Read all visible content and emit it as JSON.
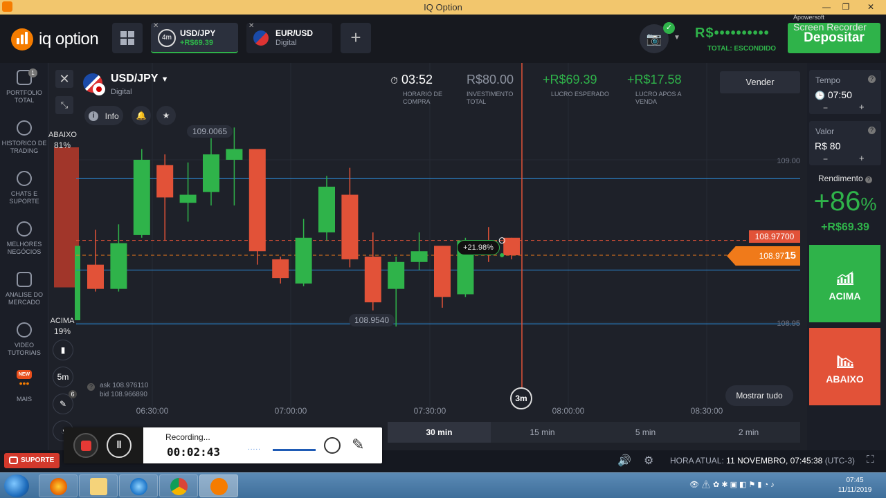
{
  "window": {
    "title": "IQ Option",
    "controls": [
      "—",
      "❐",
      "✕"
    ]
  },
  "header": {
    "logo_text": "iq option",
    "tabs": [
      {
        "badge": "4m",
        "name": "USD/JPY",
        "sub": "+R$69.39"
      },
      {
        "name": "EUR/USD",
        "sub": "Digital"
      }
    ],
    "add_tab": "+",
    "balance": "R$••••••••••",
    "balance_sub": "TOTAL: ESCONDIDO",
    "deposit": "Depositar"
  },
  "watermark": {
    "line1": "Apowersoft",
    "line2": "Screen Recorder"
  },
  "sidebar": {
    "portfolio_badge": "1",
    "items": [
      "PORTFOLIO TOTAL",
      "HISTORICO DE TRADING",
      "CHATS E SUPORTE",
      "MELHORES NEGÓCIOS",
      "ANALISE DO MERCADO",
      "VIDEO TUTORIAIS",
      "MAIS"
    ],
    "new_badge": "NEW"
  },
  "asset": {
    "name": "USD/JPY",
    "type": "Digital",
    "info": "Info"
  },
  "sentiment": {
    "down_label": "ABAIXO",
    "down_pct": "81%",
    "up_label": "ACIMA",
    "up_pct": "19%",
    "down_share": 0.81
  },
  "tools": {
    "timeframe": "5m",
    "draw_badge": "6"
  },
  "stats": {
    "timer": "03:52",
    "timer_label": "HORARIO DE COMPRA",
    "investment": "R$80.00",
    "investment_label": "INVESTIMENTO TOTAL",
    "expected": "+R$69.39",
    "expected_label": "LUCRO ESPERADO",
    "after_sale": "+R$17.58",
    "after_sale_label": "LUCRO APOS A VENDA",
    "sell": "Vender"
  },
  "chart_data": {
    "type": "candlestick",
    "x_labels": [
      "06:30:00",
      "07:00:00",
      "07:30:00",
      "08:00:00",
      "08:30:00"
    ],
    "y_labels": [
      "109.00",
      "108.95"
    ],
    "candles": [
      {
        "o": 108.968,
        "c": 108.959,
        "h": 108.981,
        "l": 108.958
      },
      {
        "o": 108.959,
        "c": 108.976,
        "h": 108.983,
        "l": 108.958
      },
      {
        "o": 108.979,
        "c": 109.007,
        "h": 109.011,
        "l": 108.978
      },
      {
        "o": 109.005,
        "c": 108.993,
        "h": 109.009,
        "l": 108.977
      },
      {
        "o": 108.991,
        "c": 108.994,
        "h": 109.006,
        "l": 108.984
      },
      {
        "o": 108.995,
        "c": 109.009,
        "h": 109.015,
        "l": 108.99
      },
      {
        "o": 109.007,
        "c": 109.011,
        "h": 109.019,
        "l": 108.99
      },
      {
        "o": 109.011,
        "c": 108.973,
        "h": 109.011,
        "l": 108.968
      },
      {
        "o": 108.97,
        "c": 108.963,
        "h": 108.971,
        "l": 108.961
      },
      {
        "o": 108.961,
        "c": 108.978,
        "h": 108.985,
        "l": 108.96
      },
      {
        "o": 108.98,
        "c": 108.997,
        "h": 109.001,
        "l": 108.977
      },
      {
        "o": 108.994,
        "c": 108.97,
        "h": 109.004,
        "l": 108.967
      },
      {
        "o": 108.971,
        "c": 108.954,
        "h": 108.98,
        "l": 108.951
      },
      {
        "o": 108.959,
        "c": 108.969,
        "h": 108.971,
        "l": 108.945
      },
      {
        "o": 108.969,
        "c": 108.973,
        "h": 108.98,
        "l": 108.966
      },
      {
        "o": 108.975,
        "c": 108.956,
        "h": 108.975,
        "l": 108.952
      },
      {
        "o": 108.957,
        "c": 108.977,
        "h": 108.978,
        "l": 108.956
      },
      {
        "o": 108.977,
        "c": 108.974,
        "h": 108.982,
        "l": 108.969
      },
      {
        "o": 108.978,
        "c": 108.9715,
        "h": 108.978,
        "l": 108.97
      }
    ],
    "y_range": [
      108.935,
      109.025
    ],
    "lines": {
      "strike": 108.977,
      "current": 108.9715,
      "blue_levels": [
        109.0,
        108.966,
        108.946
      ]
    },
    "annotations": {
      "high": "109.0065",
      "low": "108.9540",
      "strike_tag": "108.97700",
      "price_main": "108.97",
      "price_tail": "15",
      "profit_pct": "+21.98%",
      "expiry": "3m"
    }
  },
  "ask_bid": {
    "ask": "ask 108.976110",
    "bid": "bid 108.966890"
  },
  "mostrar": "Mostrar tudo",
  "periods": [
    "30 min",
    "15 min",
    "5 min",
    "2 min"
  ],
  "right": {
    "tempo_label": "Tempo",
    "tempo_value": "07:50",
    "valor_label": "Valor",
    "valor_value": "R$ 80",
    "minus": "−",
    "plus": "+",
    "rendimento_label": "Rendimento",
    "rendimento_pct": "+86",
    "rendimento_sym": "%",
    "rendimento_amt": "+R$69.39",
    "up_btn": "ACIMA",
    "down_btn": "ABAIXO",
    "help": "?"
  },
  "status": {
    "support": "SUPORTE",
    "time_label": "HORA ATUAL:",
    "time_value": "11 NOVEMBRO, 07:45:38",
    "tz": "(UTC-3)"
  },
  "recorder": {
    "status": "Recording...",
    "time": "00:02:43",
    "wave": "....."
  },
  "taskbar": {
    "clock_time": "07:45",
    "clock_date": "11/11/2019"
  },
  "colors": {
    "green": "#2fb34a",
    "red": "#e25238",
    "orange": "#f07a1a",
    "blue_line": "#2b7fc4"
  }
}
